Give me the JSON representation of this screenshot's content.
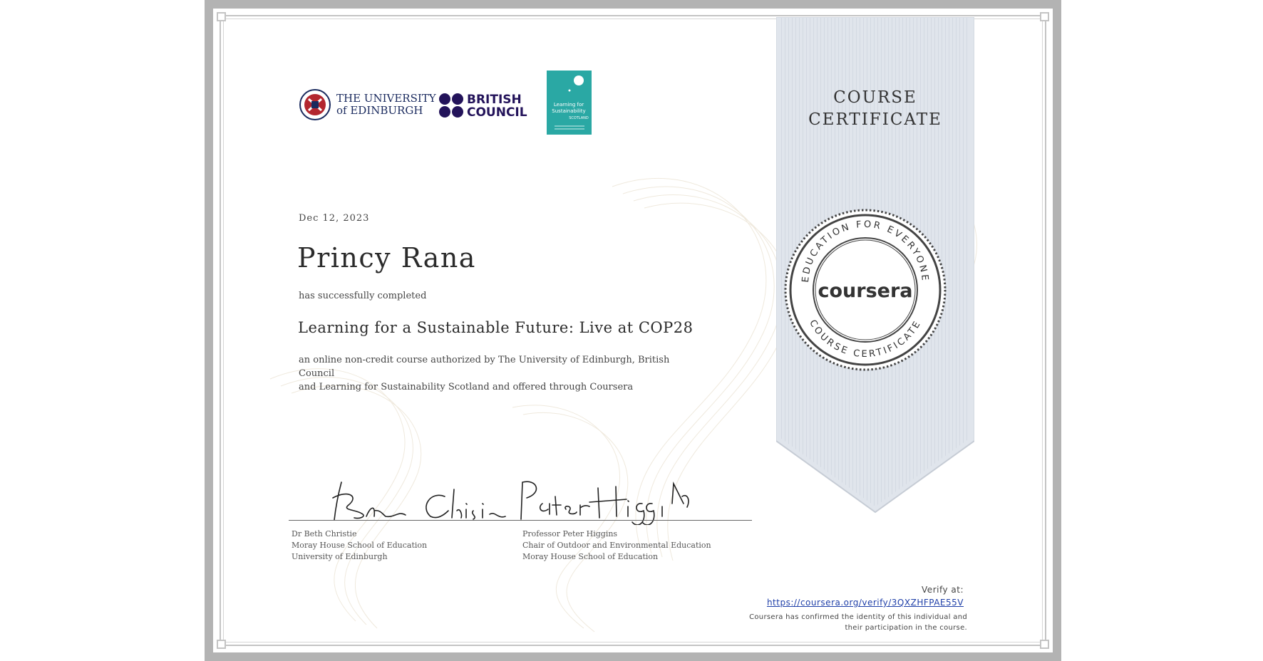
{
  "logos": {
    "edinburgh_line1": "THE UNIVERSITY",
    "edinburgh_line2": "of EDINBURGH",
    "british_line1": "BRITISH",
    "british_line2": "COUNCIL",
    "lfs_line1": "Learning for",
    "lfs_line2": "Sustainability",
    "lfs_line3": "SCOTLAND"
  },
  "certificate": {
    "date": "Dec 12, 2023",
    "recipient": "Princy Rana",
    "completed_text": "has successfully completed",
    "course_title": "Learning for a Sustainable Future: Live at COP28",
    "description_line1": "an online non-credit course authorized by The University of Edinburgh, British Council",
    "description_line2": "and Learning for Sustainability Scotland and offered through Coursera"
  },
  "ribbon": {
    "title_line1": "COURSE",
    "title_line2": "CERTIFICATE",
    "seal_brand": "coursera",
    "seal_top_text": "EDUCATION FOR EVERYONE",
    "seal_bottom_text": "COURSE CERTIFICATE"
  },
  "signatories": [
    {
      "name": "Dr Beth Christie",
      "line2": "Moray House School of Education",
      "line3": "University of Edinburgh",
      "signature": "Beth Christie"
    },
    {
      "name": "Professor Peter Higgins",
      "line2": "Chair of Outdoor and Environmental Education",
      "line3": "Moray House School of Education",
      "signature": "Peter Higgins"
    }
  ],
  "verification": {
    "label": "Verify at:",
    "url": "https://coursera.org/verify/3QXZHFPAE55V",
    "confirm_line1": "Coursera has confirmed the identity of this individual and",
    "confirm_line2": "their participation in the course."
  },
  "colors": {
    "frame": "#b3b3b3",
    "ribbon": "#e0e5ec",
    "link": "#1f3fa8",
    "british_council": "#23135a",
    "lfs_teal": "#2aa8a4",
    "edinburgh_red": "#b3262e",
    "edinburgh_navy": "#1a2a5e"
  }
}
